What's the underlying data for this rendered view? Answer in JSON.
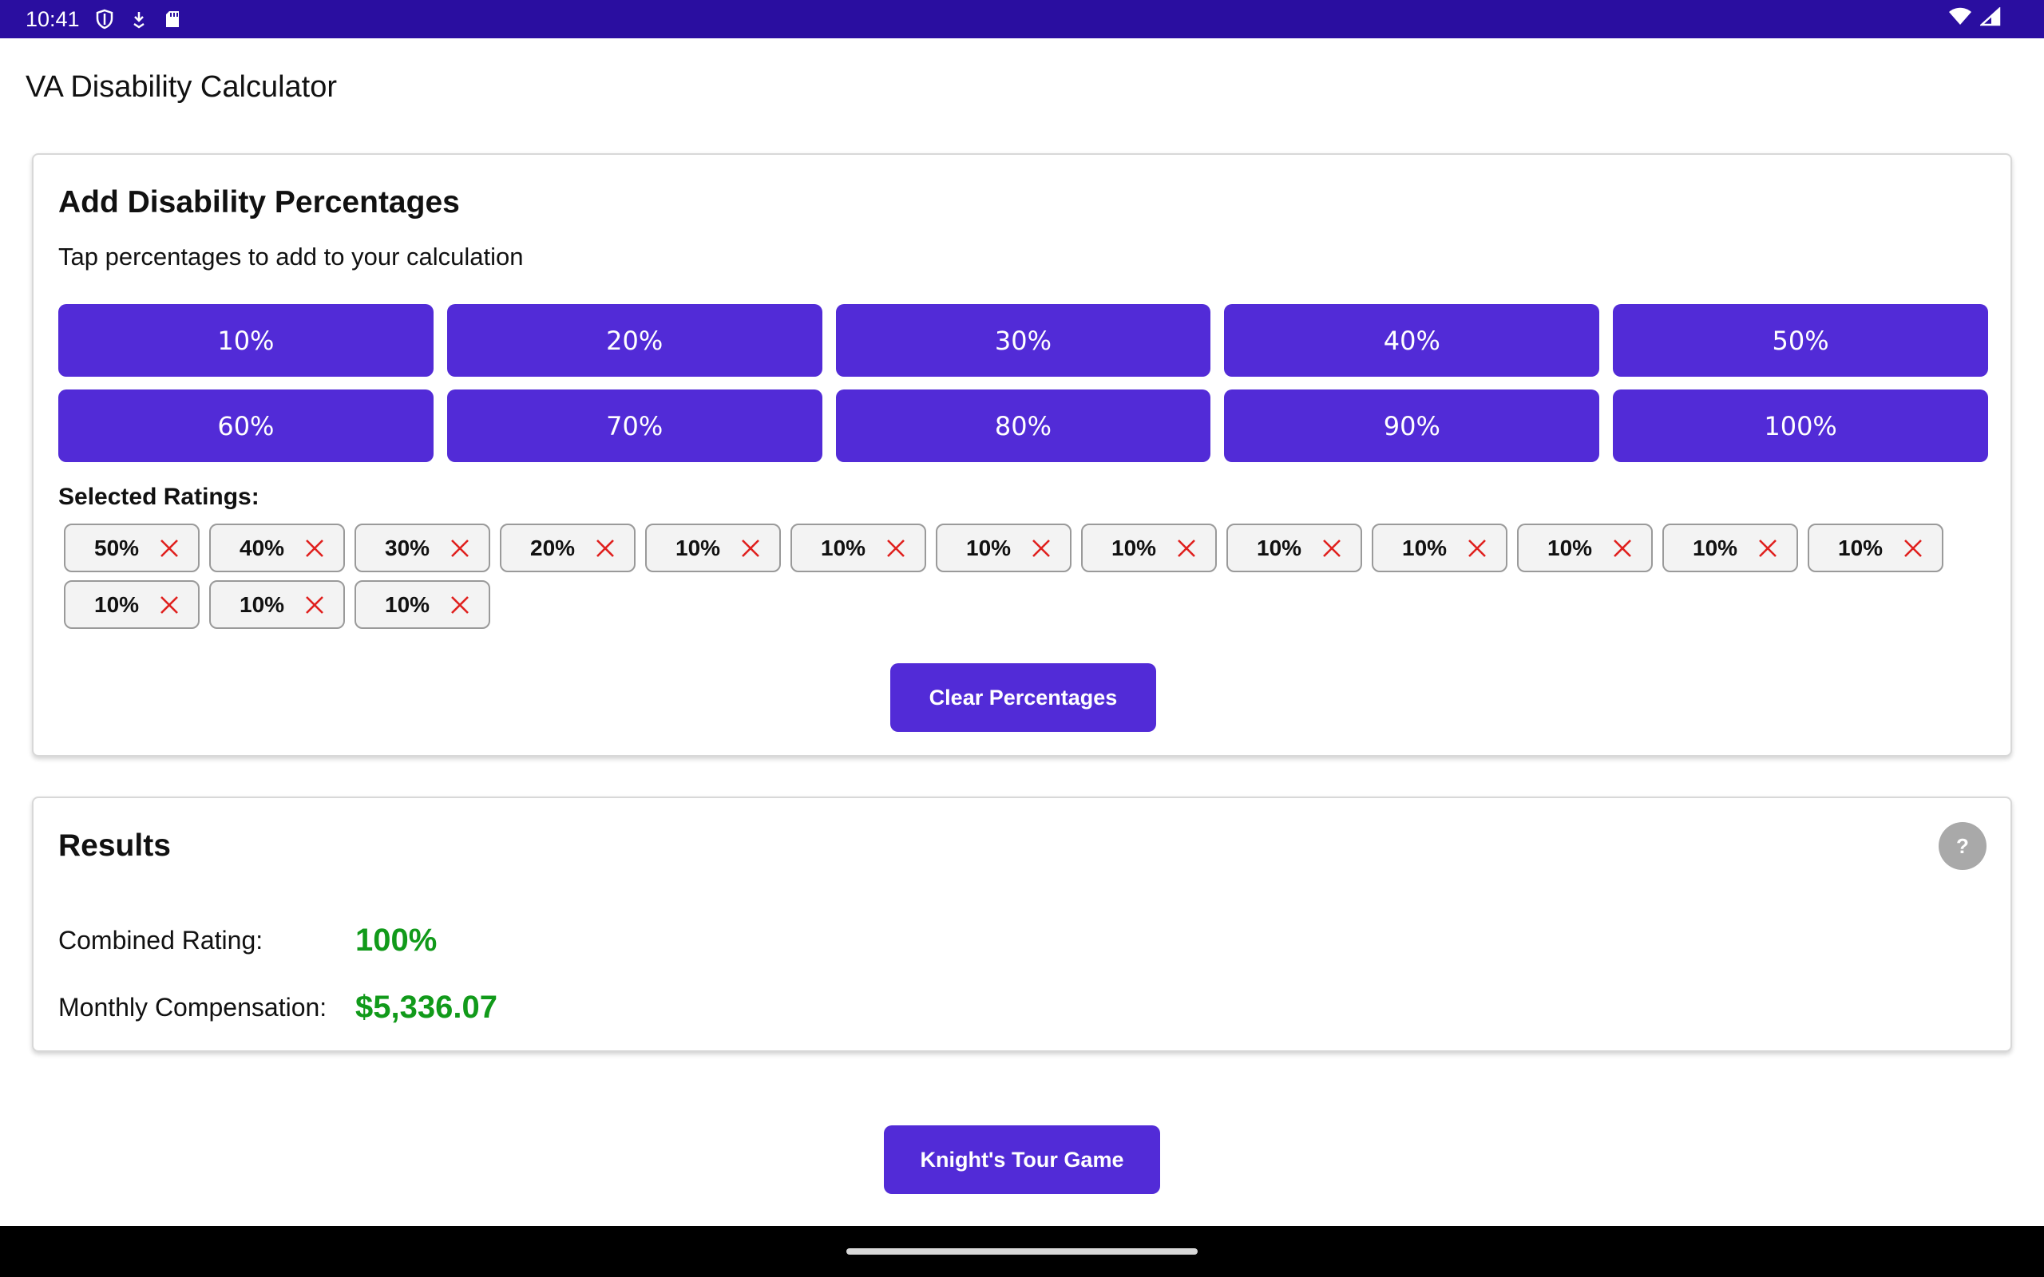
{
  "status_bar": {
    "time": "10:41",
    "icons": [
      "shield-icon",
      "download-icon",
      "sd-card-icon",
      "wifi-icon",
      "signal-icon"
    ],
    "color": "#2a0ea0"
  },
  "app": {
    "title": "VA Disability Calculator"
  },
  "add_card": {
    "title": "Add Disability Percentages",
    "subtitle": "Tap percentages to add to your calculation",
    "percent_buttons": [
      "10%",
      "20%",
      "30%",
      "40%",
      "50%",
      "60%",
      "70%",
      "80%",
      "90%",
      "100%"
    ],
    "selected_label": "Selected Ratings:",
    "selected_ratings": [
      "50%",
      "40%",
      "30%",
      "20%",
      "10%",
      "10%",
      "10%",
      "10%",
      "10%",
      "10%",
      "10%",
      "10%",
      "10%",
      "10%",
      "10%",
      "10%"
    ],
    "clear_label": "Clear Percentages"
  },
  "results_card": {
    "title": "Results",
    "help_label": "?",
    "combined_label": "Combined Rating:",
    "combined_value": "100%",
    "monthly_label": "Monthly Compensation:",
    "monthly_value": "$5,336.07"
  },
  "footer": {
    "knight_label": "Knight's Tour Game"
  },
  "colors": {
    "accent": "#522bd7",
    "value_green": "#119a1a",
    "remove_red": "#e0201e"
  }
}
